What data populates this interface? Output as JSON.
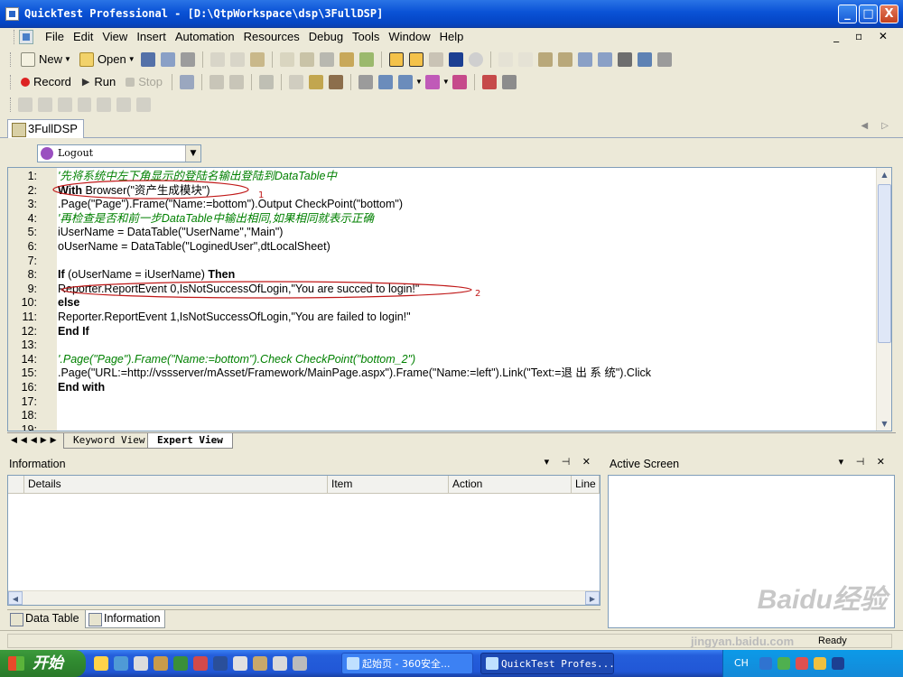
{
  "window": {
    "title": "QuickTest Professional - [D:\\QtpWorkspace\\dsp\\3FullDSP]",
    "controls": [
      "_",
      "□",
      "X"
    ]
  },
  "menu": [
    "File",
    "Edit",
    "View",
    "Insert",
    "Automation",
    "Resources",
    "Debug",
    "Tools",
    "Window",
    "Help"
  ],
  "toolbar": {
    "new_label": "New",
    "open_label": "Open",
    "record_label": "Record",
    "run_label": "Run",
    "stop_label": "Stop"
  },
  "document_tab": "3FullDSP",
  "action_selector": "Logout",
  "code": [
    {
      "n": "1:",
      "text": "'先将系统中左下角显示的登陆名输出登陆到DataTable中",
      "style": "comment"
    },
    {
      "n": "2:",
      "text": "With Browser(\"资产生成模块\")",
      "style": "with"
    },
    {
      "n": "3:",
      "text": " .Page(\"Page\").Frame(\"Name:=bottom\").Output CheckPoint(\"bottom\")",
      "style": "plain"
    },
    {
      "n": "4:",
      "text": " '再检查是否和前一步DataTable中输出相同,如果相同就表示正确",
      "style": "comment"
    },
    {
      "n": "5:",
      "text": " iUserName = DataTable(\"UserName\",\"Main\")",
      "style": "plain"
    },
    {
      "n": "6:",
      "text": " oUserName = DataTable(\"LoginedUser\",dtLocalSheet)",
      "style": "plain"
    },
    {
      "n": "7:",
      "text": "",
      "style": "plain"
    },
    {
      "n": "8:",
      "text": "If (oUserName = iUserName) Then",
      "style": "if"
    },
    {
      "n": "9:",
      "text": "   Reporter.ReportEvent 0,IsNotSuccessOfLogin,\"You are succed to login!\"",
      "style": "plain"
    },
    {
      "n": "10:",
      "text": "else",
      "style": "kw"
    },
    {
      "n": "11:",
      "text": "   Reporter.ReportEvent 1,IsNotSuccessOfLogin,\"You are failed to  login!\"",
      "style": "plain"
    },
    {
      "n": "12:",
      "text": " End If",
      "style": "kw"
    },
    {
      "n": "13:",
      "text": "",
      "style": "plain"
    },
    {
      "n": "14:",
      "text": "  '.Page(\"Page\").Frame(\"Name:=bottom\").Check CheckPoint(\"bottom_2\")",
      "style": "comment"
    },
    {
      "n": "15:",
      "text": " .Page(\"URL:=http://vssserver/mAsset/Framework/MainPage.aspx\").Frame(\"Name:=left\").Link(\"Text:=退 出 系 统\").Click",
      "style": "plain"
    },
    {
      "n": "16:",
      "text": "End with",
      "style": "kw"
    },
    {
      "n": "17:",
      "text": "",
      "style": "plain"
    },
    {
      "n": "18:",
      "text": "",
      "style": "plain"
    },
    {
      "n": "19:",
      "text": "",
      "style": "plain"
    }
  ],
  "annotations": {
    "one": "1",
    "two": "2"
  },
  "view_tabs": {
    "keyword": "Keyword View",
    "expert": "Expert View"
  },
  "information_panel": {
    "title": "Information",
    "columns": [
      "Details",
      "Item",
      "Action",
      "Line"
    ]
  },
  "active_screen_panel": {
    "title": "Active Screen"
  },
  "bottom_tabs": {
    "data_table": "Data Table",
    "information": "Information"
  },
  "status": {
    "ready": "Ready"
  },
  "taskbar": {
    "start_label": "开始",
    "task1": "起始页 - 360安全...",
    "task2": "QuickTest Profes...",
    "tray_lang": "CH"
  },
  "watermark": {
    "line1": "Baidu经验",
    "line2": "jingyan.baidu.com"
  }
}
